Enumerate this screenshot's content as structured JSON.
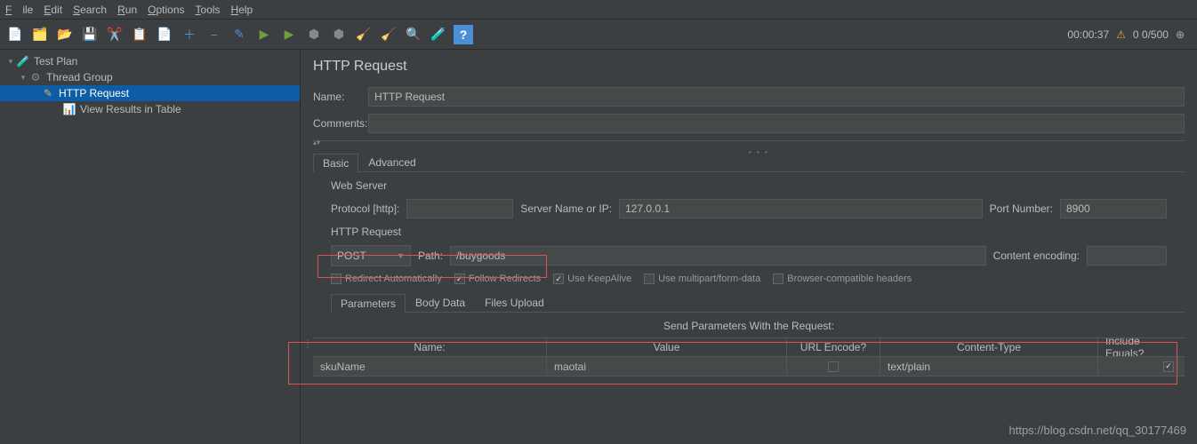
{
  "menu": {
    "file": "File",
    "edit": "Edit",
    "search": "Search",
    "run": "Run",
    "options": "Options",
    "tools": "Tools",
    "help": "Help"
  },
  "timer": "00:00:37",
  "counts": "0  0/500",
  "tree": {
    "testplan": "Test Plan",
    "threadgroup": "Thread Group",
    "httprequest": "HTTP Request",
    "viewresults": "View Results in Table"
  },
  "panel": {
    "title": "HTTP Request",
    "name_lbl": "Name:",
    "name_val": "HTTP Request",
    "comments_lbl": "Comments:",
    "tabs": {
      "basic": "Basic",
      "advanced": "Advanced"
    },
    "web_server": "Web Server",
    "protocol_lbl": "Protocol [http]:",
    "protocol_val": "",
    "server_lbl": "Server Name or IP:",
    "server_val": "127.0.0.1",
    "port_lbl": "Port Number:",
    "port_val": "8900",
    "http_req": "HTTP Request",
    "method": "POST",
    "path_lbl": "Path:",
    "path_val": "/buygoods",
    "ce_lbl": "Content encoding:",
    "ce_val": "",
    "checks": {
      "redirect": "Redirect Automatically",
      "follow": "Follow Redirects",
      "keepalive": "Use KeepAlive",
      "multipart": "Use multipart/form-data",
      "browser": "Browser-compatible headers"
    },
    "ptabs": {
      "params": "Parameters",
      "body": "Body Data",
      "files": "Files Upload"
    },
    "send_lbl": "Send Parameters With the Request:",
    "cols": {
      "name": "Name:",
      "value": "Value",
      "url": "URL Encode?",
      "ct": "Content-Type",
      "eq": "Include Equals?"
    },
    "rows": [
      {
        "name": "skuName",
        "value": "maotai",
        "url": false,
        "ct": "text/plain",
        "eq": true
      }
    ]
  },
  "watermark": "https://blog.csdn.net/qq_30177469"
}
